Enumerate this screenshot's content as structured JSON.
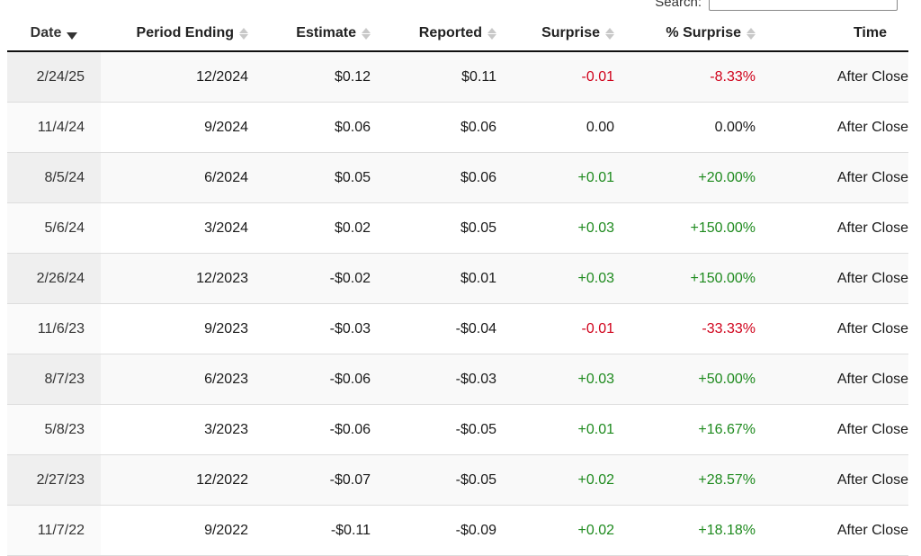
{
  "search": {
    "label": "Search:",
    "value": ""
  },
  "columns": {
    "date": "Date",
    "period": "Period Ending",
    "estimate": "Estimate",
    "reported": "Reported",
    "surprise": "Surprise",
    "pct_surprise": "% Surprise",
    "time": "Time"
  },
  "sort": {
    "column": "date",
    "direction": "descending"
  },
  "status_colors": {
    "negative": "#d0021b",
    "positive": "#1e8a1e"
  },
  "rows": [
    {
      "date": "2/24/25",
      "period": "12/2024",
      "estimate": "$0.12",
      "reported": "$0.11",
      "surprise": "-0.01",
      "pct_surprise": "-8.33%",
      "time": "After Close",
      "sign": "neg"
    },
    {
      "date": "11/4/24",
      "period": "9/2024",
      "estimate": "$0.06",
      "reported": "$0.06",
      "surprise": "0.00",
      "pct_surprise": "0.00%",
      "time": "After Close",
      "sign": "zero"
    },
    {
      "date": "8/5/24",
      "period": "6/2024",
      "estimate": "$0.05",
      "reported": "$0.06",
      "surprise": "+0.01",
      "pct_surprise": "+20.00%",
      "time": "After Close",
      "sign": "pos"
    },
    {
      "date": "5/6/24",
      "period": "3/2024",
      "estimate": "$0.02",
      "reported": "$0.05",
      "surprise": "+0.03",
      "pct_surprise": "+150.00%",
      "time": "After Close",
      "sign": "pos"
    },
    {
      "date": "2/26/24",
      "period": "12/2023",
      "estimate": "-$0.02",
      "reported": "$0.01",
      "surprise": "+0.03",
      "pct_surprise": "+150.00%",
      "time": "After Close",
      "sign": "pos"
    },
    {
      "date": "11/6/23",
      "period": "9/2023",
      "estimate": "-$0.03",
      "reported": "-$0.04",
      "surprise": "-0.01",
      "pct_surprise": "-33.33%",
      "time": "After Close",
      "sign": "neg"
    },
    {
      "date": "8/7/23",
      "period": "6/2023",
      "estimate": "-$0.06",
      "reported": "-$0.03",
      "surprise": "+0.03",
      "pct_surprise": "+50.00%",
      "time": "After Close",
      "sign": "pos"
    },
    {
      "date": "5/8/23",
      "period": "3/2023",
      "estimate": "-$0.06",
      "reported": "-$0.05",
      "surprise": "+0.01",
      "pct_surprise": "+16.67%",
      "time": "After Close",
      "sign": "pos"
    },
    {
      "date": "2/27/23",
      "period": "12/2022",
      "estimate": "-$0.07",
      "reported": "-$0.05",
      "surprise": "+0.02",
      "pct_surprise": "+28.57%",
      "time": "After Close",
      "sign": "pos"
    },
    {
      "date": "11/7/22",
      "period": "9/2022",
      "estimate": "-$0.11",
      "reported": "-$0.09",
      "surprise": "+0.02",
      "pct_surprise": "+18.18%",
      "time": "After Close",
      "sign": "pos"
    }
  ]
}
